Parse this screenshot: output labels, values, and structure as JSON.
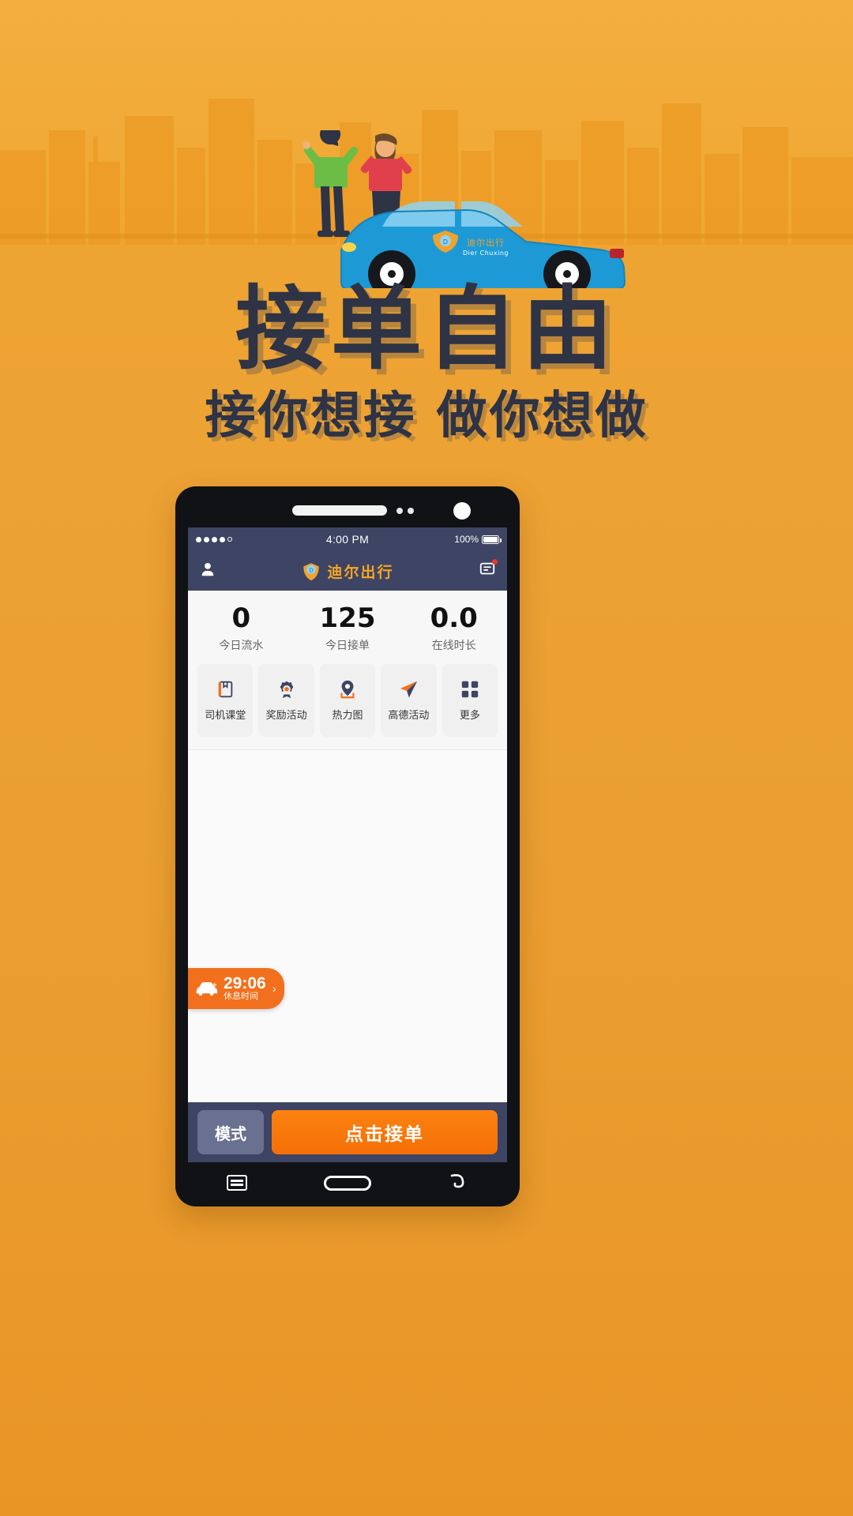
{
  "poster": {
    "title": "接单自由",
    "subtitle": "接你想接 做你想做",
    "brand_colors": {
      "background_orange": "#eda436",
      "title_navy": "#2e3345",
      "car_blue": "#1d9ad6",
      "accent_orange": "#f2701d"
    }
  },
  "hero": {
    "car_logo_cn": "迪尔出行",
    "car_logo_en": "Dier Chuxing"
  },
  "phone": {
    "status_bar": {
      "signal_icon": "signal-dots-icon",
      "time": "4:00 PM",
      "battery_percent": "100%",
      "battery_icon": "battery-full-icon"
    },
    "app_bar": {
      "profile_icon": "person-icon",
      "logo_icon": "shield-logo-icon",
      "brand_name": "迪尔出行",
      "message_icon": "message-icon",
      "message_badge": ""
    },
    "stats": [
      {
        "value": "0",
        "label": "今日流水"
      },
      {
        "value": "125",
        "label": "今日接单"
      },
      {
        "value": "0.0",
        "label": "在线时长"
      }
    ],
    "quick_actions": [
      {
        "label": "司机课堂",
        "icon": "book-icon"
      },
      {
        "label": "奖励活动",
        "icon": "medal-icon"
      },
      {
        "label": "热力图",
        "icon": "map-pin-icon"
      },
      {
        "label": "高德活动",
        "icon": "paper-plane-icon"
      },
      {
        "label": "更多",
        "icon": "grid-icon"
      }
    ],
    "timer_pill": {
      "car_icon": "car-icon",
      "time": "29:06",
      "label": "休息时间",
      "chevron": "›"
    },
    "action_bar": {
      "mode_label": "模式",
      "accept_label": "点击接单"
    },
    "nav_bar": {
      "recent_icon": "recent-apps-icon",
      "home_icon": "home-pill-icon",
      "back_icon": "back-icon"
    }
  }
}
